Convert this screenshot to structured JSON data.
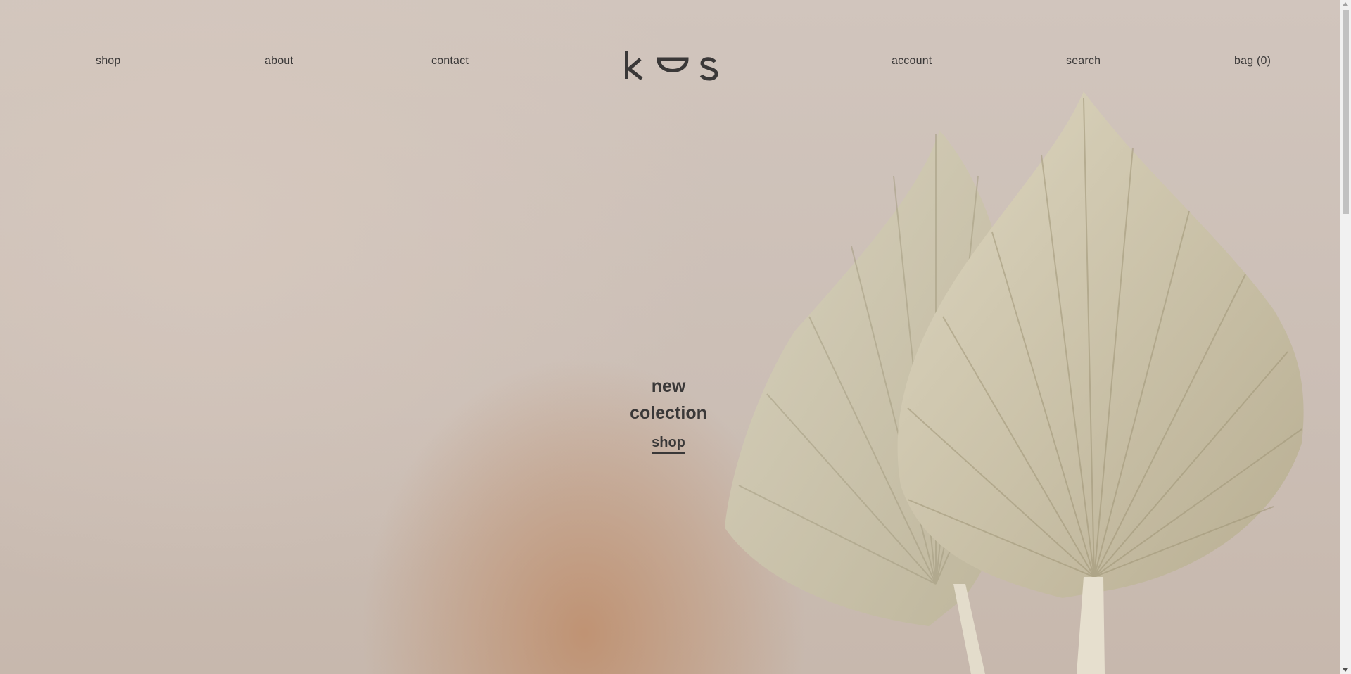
{
  "nav": {
    "left": [
      {
        "label": "shop"
      },
      {
        "label": "about"
      },
      {
        "label": "contact"
      }
    ],
    "right": [
      {
        "label": "account"
      },
      {
        "label": "search"
      },
      {
        "label": "bag (0)"
      }
    ],
    "logo_text": "k u s"
  },
  "hero": {
    "title_line1": "new",
    "title_line2": "colection",
    "link_label": "shop"
  },
  "colors": {
    "text": "#3a3838",
    "background": "#cfc3ba",
    "leaf": "#cdc6b0"
  },
  "icons": {
    "logo": "brand-logo",
    "scroll_up": "arrow-up-icon",
    "scroll_down": "arrow-down-icon"
  }
}
